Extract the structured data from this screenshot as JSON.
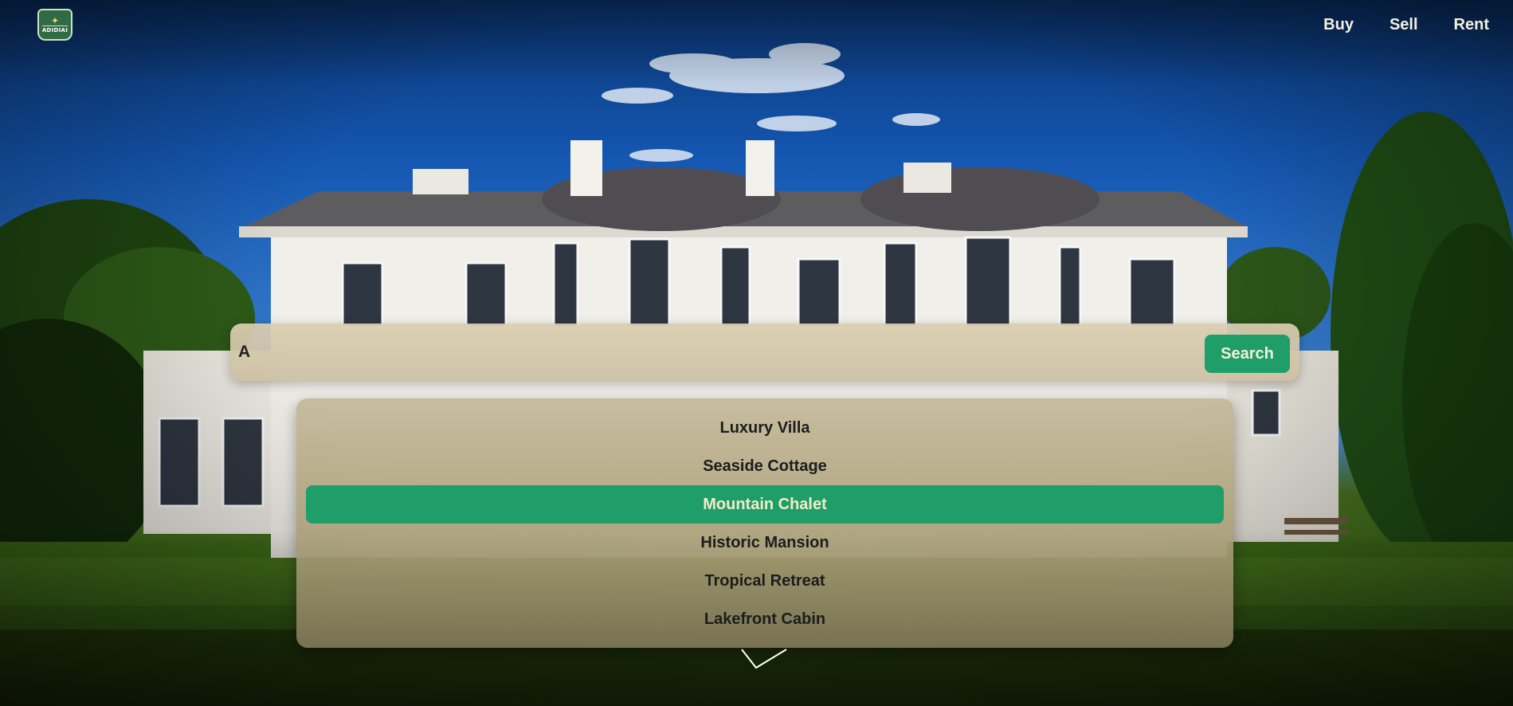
{
  "header": {
    "logo_text": "ADIDIAI",
    "nav": [
      {
        "label": "Buy"
      },
      {
        "label": "Sell"
      },
      {
        "label": "Rent"
      }
    ]
  },
  "search": {
    "value": "A",
    "placeholder": "",
    "button_label": "Search"
  },
  "suggestions": {
    "items": [
      {
        "label": "Luxury Villa"
      },
      {
        "label": "Seaside Cottage"
      },
      {
        "label": "Mountain Chalet"
      },
      {
        "label": "Historic Mansion"
      },
      {
        "label": "Tropical Retreat"
      },
      {
        "label": "Lakefront Cabin"
      }
    ],
    "active_item": "Mountain Chalet"
  },
  "colors": {
    "accent": "#1f9e6a",
    "nav_text": "#f3f0e0",
    "panel": "#cfc2a0"
  },
  "icons": {
    "scroll_indicator": "chevron-down-icon"
  }
}
